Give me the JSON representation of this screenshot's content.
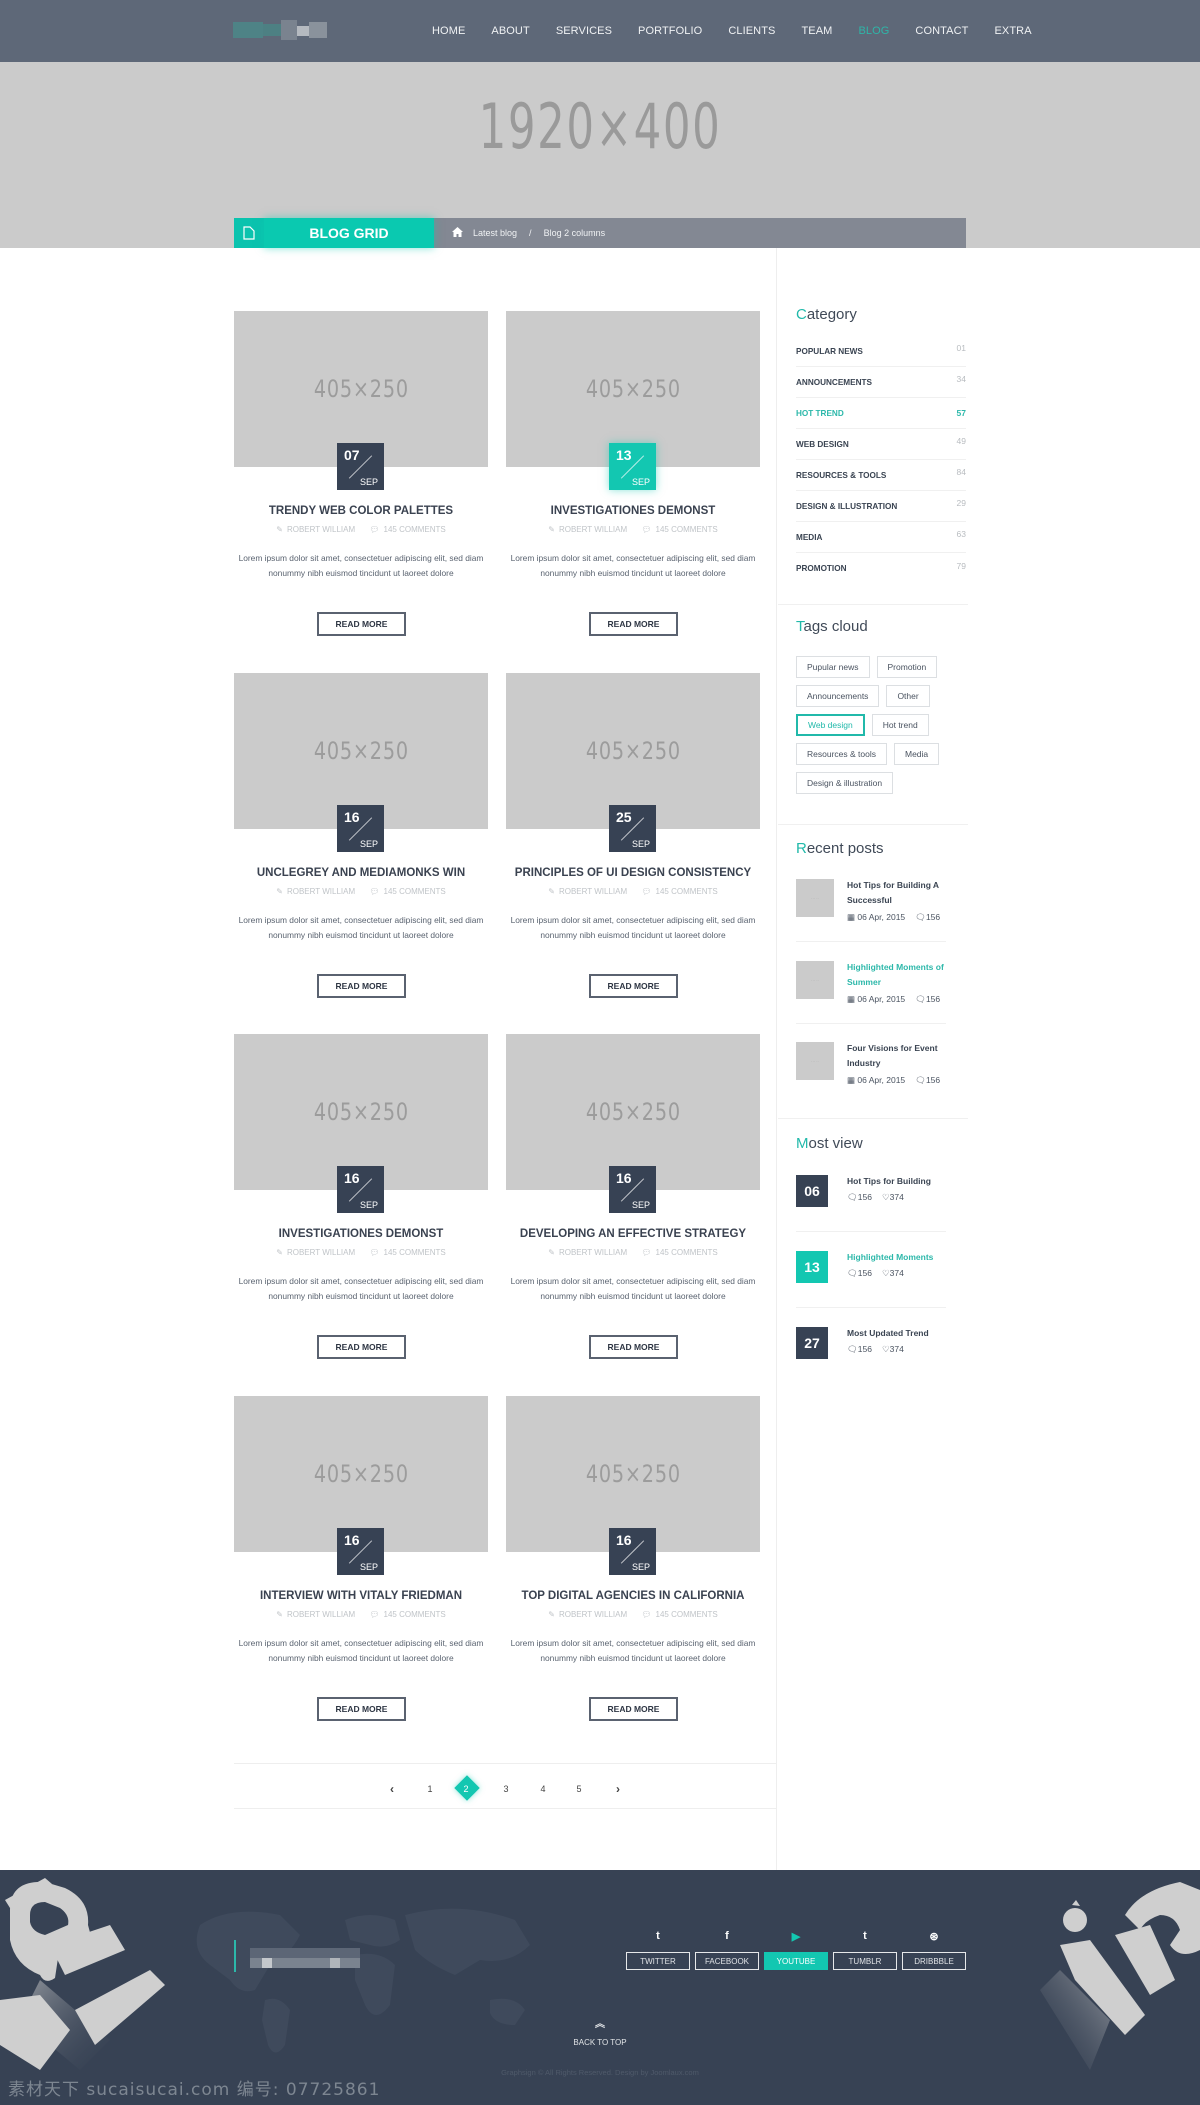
{
  "nav": {
    "items": [
      {
        "label": "HOME",
        "active": false
      },
      {
        "label": "ABOUT",
        "active": false
      },
      {
        "label": "SERVICES",
        "active": false
      },
      {
        "label": "PORTFOLIO",
        "active": false
      },
      {
        "label": "CLIENTS",
        "active": false
      },
      {
        "label": "TEAM",
        "active": false
      },
      {
        "label": "BLOG",
        "active": true
      },
      {
        "label": "CONTACT",
        "active": false
      },
      {
        "label": "EXTRA",
        "active": false
      }
    ]
  },
  "hero": {
    "placeholder": "1920×400",
    "page_title": "BLOG GRID",
    "page_icon": "document-icon",
    "breadcrumb": {
      "home_icon": "home-icon",
      "items": [
        "Latest blog",
        "Blog 2 columns"
      ],
      "separator": "/"
    }
  },
  "posts": [
    {
      "thumb": "405×250",
      "day": "07",
      "month": "SEP",
      "accent": false,
      "title": "TRENDY WEB COLOR PALETTES",
      "author": "ROBERT WILLIAM",
      "comments": "145 COMMENTS",
      "excerpt": "Lorem ipsum dolor sit amet, consectetuer adipiscing elit, sed diam nonummy nibh euismod tincidunt ut laoreet dolore",
      "button": "READ MORE"
    },
    {
      "thumb": "405×250",
      "day": "13",
      "month": "SEP",
      "accent": true,
      "title": "INVESTIGATIONES DEMONST",
      "author": "ROBERT WILLIAM",
      "comments": "145 COMMENTS",
      "excerpt": "Lorem ipsum dolor sit amet, consectetuer adipiscing elit, sed diam nonummy nibh euismod tincidunt ut laoreet dolore",
      "button": "READ MORE"
    },
    {
      "thumb": "405×250",
      "day": "16",
      "month": "SEP",
      "accent": false,
      "title": "UNCLEGREY AND MEDIAMONKS WIN",
      "author": "ROBERT WILLIAM",
      "comments": "145 COMMENTS",
      "excerpt": "Lorem ipsum dolor sit amet, consectetuer adipiscing elit, sed diam nonummy nibh euismod tincidunt ut laoreet dolore",
      "button": "READ MORE"
    },
    {
      "thumb": "405×250",
      "day": "25",
      "month": "SEP",
      "accent": false,
      "title": "PRINCIPLES OF UI DESIGN CONSISTENCY",
      "author": "ROBERT WILLIAM",
      "comments": "145 COMMENTS",
      "excerpt": "Lorem ipsum dolor sit amet, consectetuer adipiscing elit, sed diam nonummy nibh euismod tincidunt ut laoreet dolore",
      "button": "READ MORE"
    },
    {
      "thumb": "405×250",
      "day": "16",
      "month": "SEP",
      "accent": false,
      "title": "INVESTIGATIONES DEMONST",
      "author": "ROBERT WILLIAM",
      "comments": "145 COMMENTS",
      "excerpt": "Lorem ipsum dolor sit amet, consectetuer adipiscing elit, sed diam nonummy nibh euismod tincidunt ut laoreet dolore",
      "button": "READ MORE"
    },
    {
      "thumb": "405×250",
      "day": "16",
      "month": "SEP",
      "accent": false,
      "title": "DEVELOPING AN EFFECTIVE STRATEGY",
      "author": "ROBERT WILLIAM",
      "comments": "145 COMMENTS",
      "excerpt": "Lorem ipsum dolor sit amet, consectetuer adipiscing elit, sed diam nonummy nibh euismod tincidunt ut laoreet dolore",
      "button": "READ MORE"
    },
    {
      "thumb": "405×250",
      "day": "16",
      "month": "SEP",
      "accent": false,
      "title": "INTERVIEW WITH VITALY FRIEDMAN",
      "author": "ROBERT WILLIAM",
      "comments": "145 COMMENTS",
      "excerpt": "Lorem ipsum dolor sit amet, consectetuer adipiscing elit, sed diam nonummy nibh euismod tincidunt ut laoreet dolore",
      "button": "READ MORE"
    },
    {
      "thumb": "405×250",
      "day": "16",
      "month": "SEP",
      "accent": false,
      "title": "TOP DIGITAL AGENCIES IN CALIFORNIA",
      "author": "ROBERT WILLIAM",
      "comments": "145 COMMENTS",
      "excerpt": "Lorem ipsum dolor sit amet, consectetuer adipiscing elit, sed diam nonummy nibh euismod tincidunt ut laoreet dolore",
      "button": "READ MORE"
    }
  ],
  "pagination": {
    "prev": "‹",
    "next": "›",
    "pages": [
      "1",
      "2",
      "3",
      "4",
      "5"
    ],
    "current": "2"
  },
  "sidebar": {
    "category": {
      "title_first": "C",
      "title_rest": "ategory",
      "items": [
        {
          "label": "POPULAR NEWS",
          "count": "01",
          "active": false
        },
        {
          "label": "ANNOUNCEMENTS",
          "count": "34",
          "active": false
        },
        {
          "label": "HOT TREND",
          "count": "57",
          "active": true
        },
        {
          "label": "WEB DESIGN",
          "count": "49",
          "active": false
        },
        {
          "label": "RESOURCES & TOOLS",
          "count": "84",
          "active": false
        },
        {
          "label": "DESIGN & ILLUSTRATION",
          "count": "29",
          "active": false
        },
        {
          "label": "MEDIA",
          "count": "63",
          "active": false
        },
        {
          "label": "PROMOTION",
          "count": "79",
          "active": false
        }
      ]
    },
    "tags": {
      "title_first": "T",
      "title_rest": "ags cloud",
      "items": [
        {
          "label": "Pupular news",
          "active": false
        },
        {
          "label": "Promotion",
          "active": false
        },
        {
          "label": "Announcements",
          "active": false
        },
        {
          "label": "Other",
          "active": false
        },
        {
          "label": "Web design",
          "active": true
        },
        {
          "label": "Hot trend",
          "active": false
        },
        {
          "label": "Resources & tools",
          "active": false
        },
        {
          "label": "Media",
          "active": false
        },
        {
          "label": "Design & illustration",
          "active": false
        }
      ]
    },
    "recent": {
      "title_first": "R",
      "title_rest": "ecent posts",
      "items": [
        {
          "title": "Hot Tips for Building A Successful",
          "date": "06 Apr, 2015",
          "comments": "156",
          "accent": false
        },
        {
          "title": "Highlighted Moments of Summer",
          "date": "06 Apr, 2015",
          "comments": "156",
          "accent": true
        },
        {
          "title": "Four Visions for Event Industry",
          "date": "06 Apr, 2015",
          "comments": "156",
          "accent": false
        }
      ]
    },
    "most_view": {
      "title_first": "M",
      "title_rest": "ost view",
      "items": [
        {
          "day": "06",
          "title": "Hot Tips for Building",
          "comments": "156",
          "likes": "374",
          "accent": false
        },
        {
          "day": "13",
          "title": "Highlighted Moments",
          "comments": "156",
          "likes": "374",
          "accent": true
        },
        {
          "day": "27",
          "title": "Most Updated Trend",
          "comments": "156",
          "likes": "374",
          "accent": false
        }
      ]
    }
  },
  "footer": {
    "social": [
      {
        "icon": "twitter-icon",
        "glyph": "t",
        "label": "TWITTER",
        "active": false
      },
      {
        "icon": "facebook-icon",
        "glyph": "f",
        "label": "FACEBOOK",
        "active": false
      },
      {
        "icon": "youtube-icon",
        "glyph": "▶",
        "label": "YOUTUBE",
        "active": true
      },
      {
        "icon": "tumblr-icon",
        "glyph": "t",
        "label": "TUMBLR",
        "active": false
      },
      {
        "icon": "dribbble-icon",
        "glyph": "⊛",
        "label": "DRIBBBLE",
        "active": false
      }
    ],
    "back_to_top": "BACK TO TOP",
    "copyright": "Graphsign © All Rights Reserved. Design by Joomlaux.com",
    "watermark": "素材天下 sucaisucai.com  编号: 07725861"
  },
  "colors": {
    "accent": "#13c7b1",
    "nav_bg": "#5e6878",
    "dark": "#374254",
    "hero_bg": "#cbcbcb"
  }
}
